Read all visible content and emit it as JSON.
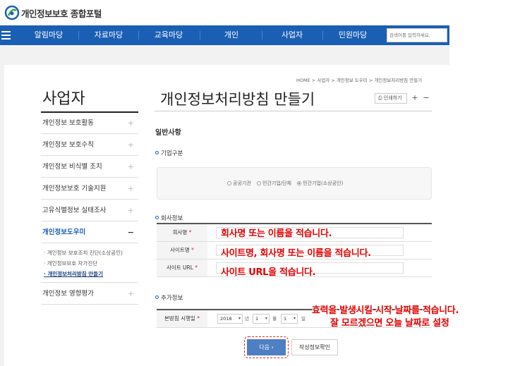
{
  "header": {
    "logo_text": "개인정보보호 종합포털"
  },
  "nav": {
    "items": [
      "알림마당",
      "자료마당",
      "교육마당",
      "개인",
      "사업자",
      "민원마당"
    ],
    "search_placeholder": "검색어를 입력하세요."
  },
  "sidebar": {
    "title": "사업자",
    "items": [
      {
        "label": "개인정보 보호활동",
        "toggle": "+"
      },
      {
        "label": "개인정보 보호수칙",
        "toggle": "+"
      },
      {
        "label": "개인정보 비식별 조치",
        "toggle": "+"
      },
      {
        "label": "개인정보보호 기술지원",
        "toggle": "+"
      },
      {
        "label": "고유식별정보 실태조사",
        "toggle": "+"
      },
      {
        "label": "개인정보도우미",
        "toggle": "−"
      }
    ],
    "subitems": [
      "· 개인정보 보호조치 진단(소상공인)",
      "· 개인정보보호 자가진단",
      "· 개인정보처리방침 만들기"
    ],
    "last_item": {
      "label": "개인정보 영향평가",
      "toggle": "+"
    }
  },
  "breadcrumb": "HOME  >  사업자  >  개인정보 도우미  >  개인정보처리방침 만들기",
  "page": {
    "title": "개인정보처리방침 만들기",
    "print_label": "인쇄하기",
    "zoom_in": "+",
    "zoom_out": "−"
  },
  "form": {
    "section_title": "일반사항",
    "company_type": {
      "heading": "기업구분",
      "options": [
        "공공기관",
        "민간기업/단체",
        "민간기업(소상공인)"
      ],
      "selected": "민간기업(소상공인)"
    },
    "company_info": {
      "heading": "회사정보",
      "fields": [
        {
          "label": "회사명",
          "required": "*",
          "value": ""
        },
        {
          "label": "사이트명",
          "required": "*",
          "value": ""
        },
        {
          "label": "사이트 URL",
          "required": "*",
          "value": ""
        }
      ]
    },
    "additional_info": {
      "heading": "추가정보",
      "date_label": "본방침 시행일",
      "required": "*",
      "year": "2018",
      "year_unit": "년",
      "month": "1",
      "month_unit": "월",
      "day": "1",
      "day_unit": "일"
    },
    "next_button": "다음  ›",
    "check_button": "작성정보확인"
  },
  "annotations": {
    "company_name": "회사명 또는 이름을 적습니다.",
    "site_name": "사이트명, 회사명 또는 이름을 적습니다.",
    "site_url": "사이트 URL을 적습니다.",
    "date_line1": "효력을 발생시킬 시작 날짜를 적습니다.",
    "date_line2": "잘 모르겠으면 오늘 날짜로 설정"
  }
}
